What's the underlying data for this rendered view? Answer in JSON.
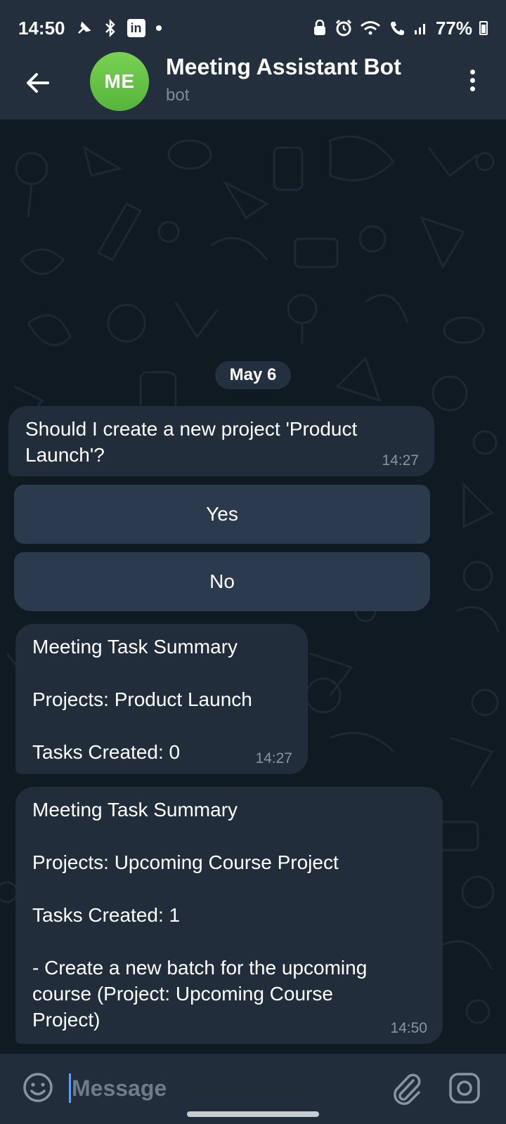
{
  "status_bar": {
    "time": "14:50",
    "battery": "77%",
    "icons": [
      "pin-icon",
      "bluetooth-icon",
      "linkedin-icon",
      "dot-icon",
      "lock-icon",
      "alarm-icon",
      "wifi-icon",
      "call-icon",
      "signal-icon",
      "battery-icon"
    ],
    "linkedin_label": "in"
  },
  "header": {
    "avatar_initials": "ME",
    "title": "Meeting Assistant Bot",
    "subtitle": "bot",
    "avatar_color": "#5cbf3e"
  },
  "chat": {
    "date_chip": "May 6",
    "messages": [
      {
        "lines": [
          "Should I create a new project 'Product",
          "Launch'?"
        ],
        "time": "14:27"
      },
      {
        "lines": [
          "Meeting Task Summary",
          "",
          "Projects: Product Launch",
          "",
          "Tasks Created: 0"
        ],
        "time": "14:27"
      },
      {
        "lines": [
          "Meeting Task Summary",
          "",
          "Projects: Upcoming Course Project",
          "",
          "Tasks Created: 1",
          "",
          "- Create a new batch for the upcoming",
          "course (Project: Upcoming Course",
          "Project)"
        ],
        "time": "14:50"
      }
    ],
    "keyboard": {
      "yes_label": "Yes",
      "no_label": "No"
    }
  },
  "input_bar": {
    "placeholder": "Message",
    "value": ""
  },
  "colors": {
    "accent": "#5aa3e8",
    "bubble": "#212d3b",
    "button": "#2b3a4c",
    "chat_bg": "#0f1a23"
  }
}
